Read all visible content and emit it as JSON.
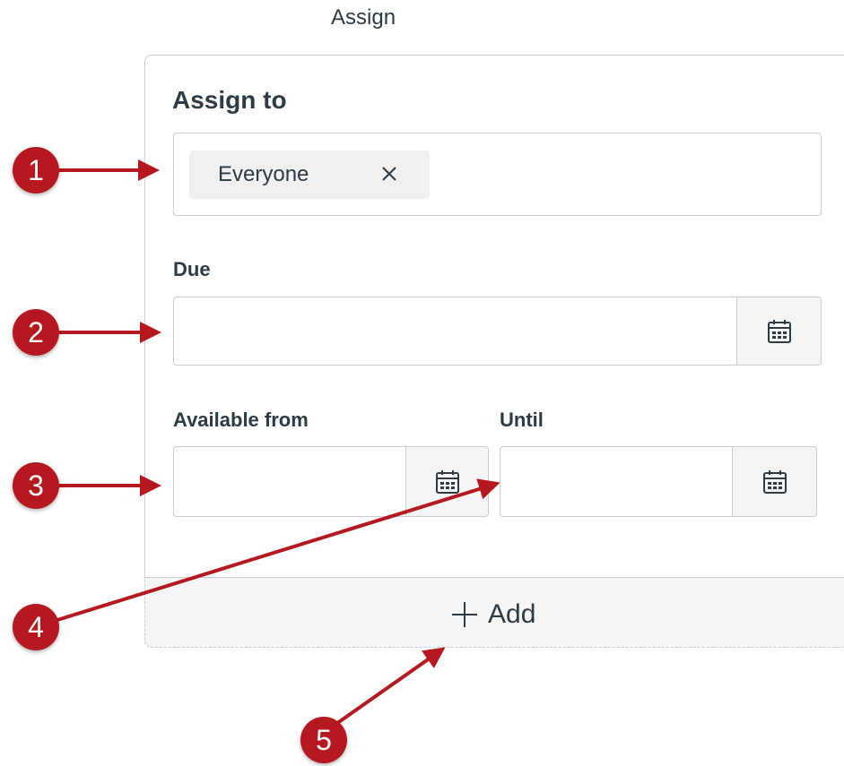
{
  "section_title": "Assign",
  "assign_to": {
    "label": "Assign to",
    "chip_text": "Everyone"
  },
  "due": {
    "label": "Due",
    "value": ""
  },
  "available_from": {
    "label": "Available from",
    "value": ""
  },
  "until": {
    "label": "Until",
    "value": ""
  },
  "add_button": {
    "label": "Add"
  },
  "callouts": [
    "1",
    "2",
    "3",
    "4",
    "5"
  ],
  "colors": {
    "callout": "#b5191f",
    "text": "#2d3b45",
    "border": "#c7cdd1",
    "footer_bg": "#f5f5f5",
    "chip_bg": "#f0f0f0"
  }
}
